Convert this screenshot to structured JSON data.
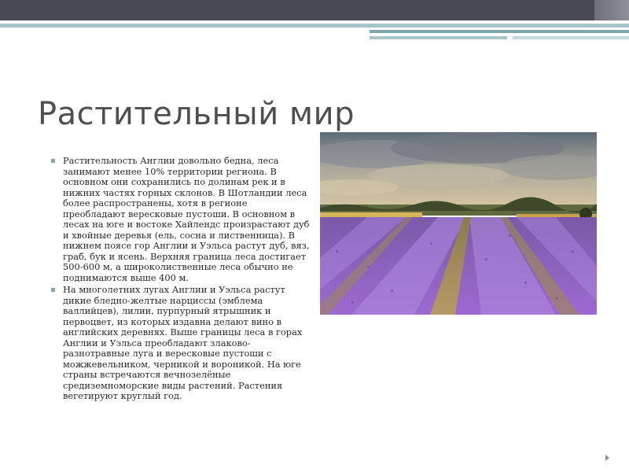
{
  "slide": {
    "title": "Растительный мир",
    "paragraphs": [
      "Растительность Англии довольно бедна, леса занимают менее 10% территории региона. В основном они сохранились по долинам рек и в нижних частях горных склонов. В Шотландии леса более распространены, хотя в регионе преобладают вересковые пустоши. В основном в лесах на юге и востоке Хайлендс произрастают дуб и хвойные деревья (ель, сосна и лиственница). В нижнем поясе гор Англии и Уэльса растут дуб, вяз, граб, бук и ясень. Верхняя граница леса достигает 500-600 м, а широколиственные леса обычно не поднимаются выше 400 м.",
      "На многолетних лугах Англии и Уэльса растут дикие бледно-желтые нарциссы (эмблема валлийцев), лилии, пурпурный ятрышник и первоцвет, из которых издавна делают вино в английских деревнях. Выше границы леса в горах Англии и Уэльса преобладают злаково-разнотравные луга и вересковые пустоши с можжевельником, черникой и вороникой. На юге страны встречаются вечнозелёные средиземноморские виды растений. Растения вегетируют круглый год."
    ],
    "bullet_glyph": "▪",
    "photo_icon": "lavender-field-photo"
  },
  "colors": {
    "top_band": "#4a4a55",
    "accent_teal": "#7fa6ad",
    "title": "#4f4f4f",
    "body_text": "#2a2a2a",
    "lavender": "#8a5fc2"
  }
}
